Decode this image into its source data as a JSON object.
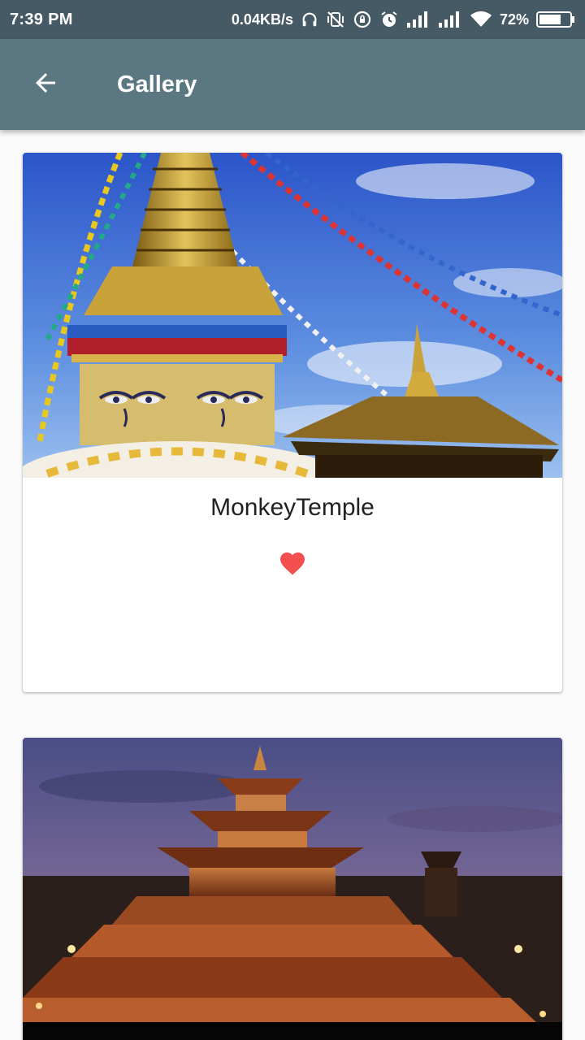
{
  "status_bar": {
    "time": "7:39 PM",
    "network_speed": "0.04KB/s",
    "battery_percent": "72%",
    "battery_level": 0.72,
    "icons": [
      "headset-icon",
      "vibrate-off-icon",
      "rotation-lock-icon",
      "alarm-icon",
      "signal-icon",
      "signal-icon",
      "wifi-icon",
      "battery-icon"
    ]
  },
  "app_bar": {
    "title": "Gallery",
    "back_icon": "arrow-back-icon",
    "background": "#5b7782"
  },
  "cards": [
    {
      "title": "MonkeyTemple",
      "liked": true,
      "heart_color": "#f44f4f"
    },
    {
      "title": ""
    }
  ],
  "colors": {
    "status_bar": "#455a64",
    "page_background": "#fafafa",
    "card_background": "#ffffff"
  }
}
